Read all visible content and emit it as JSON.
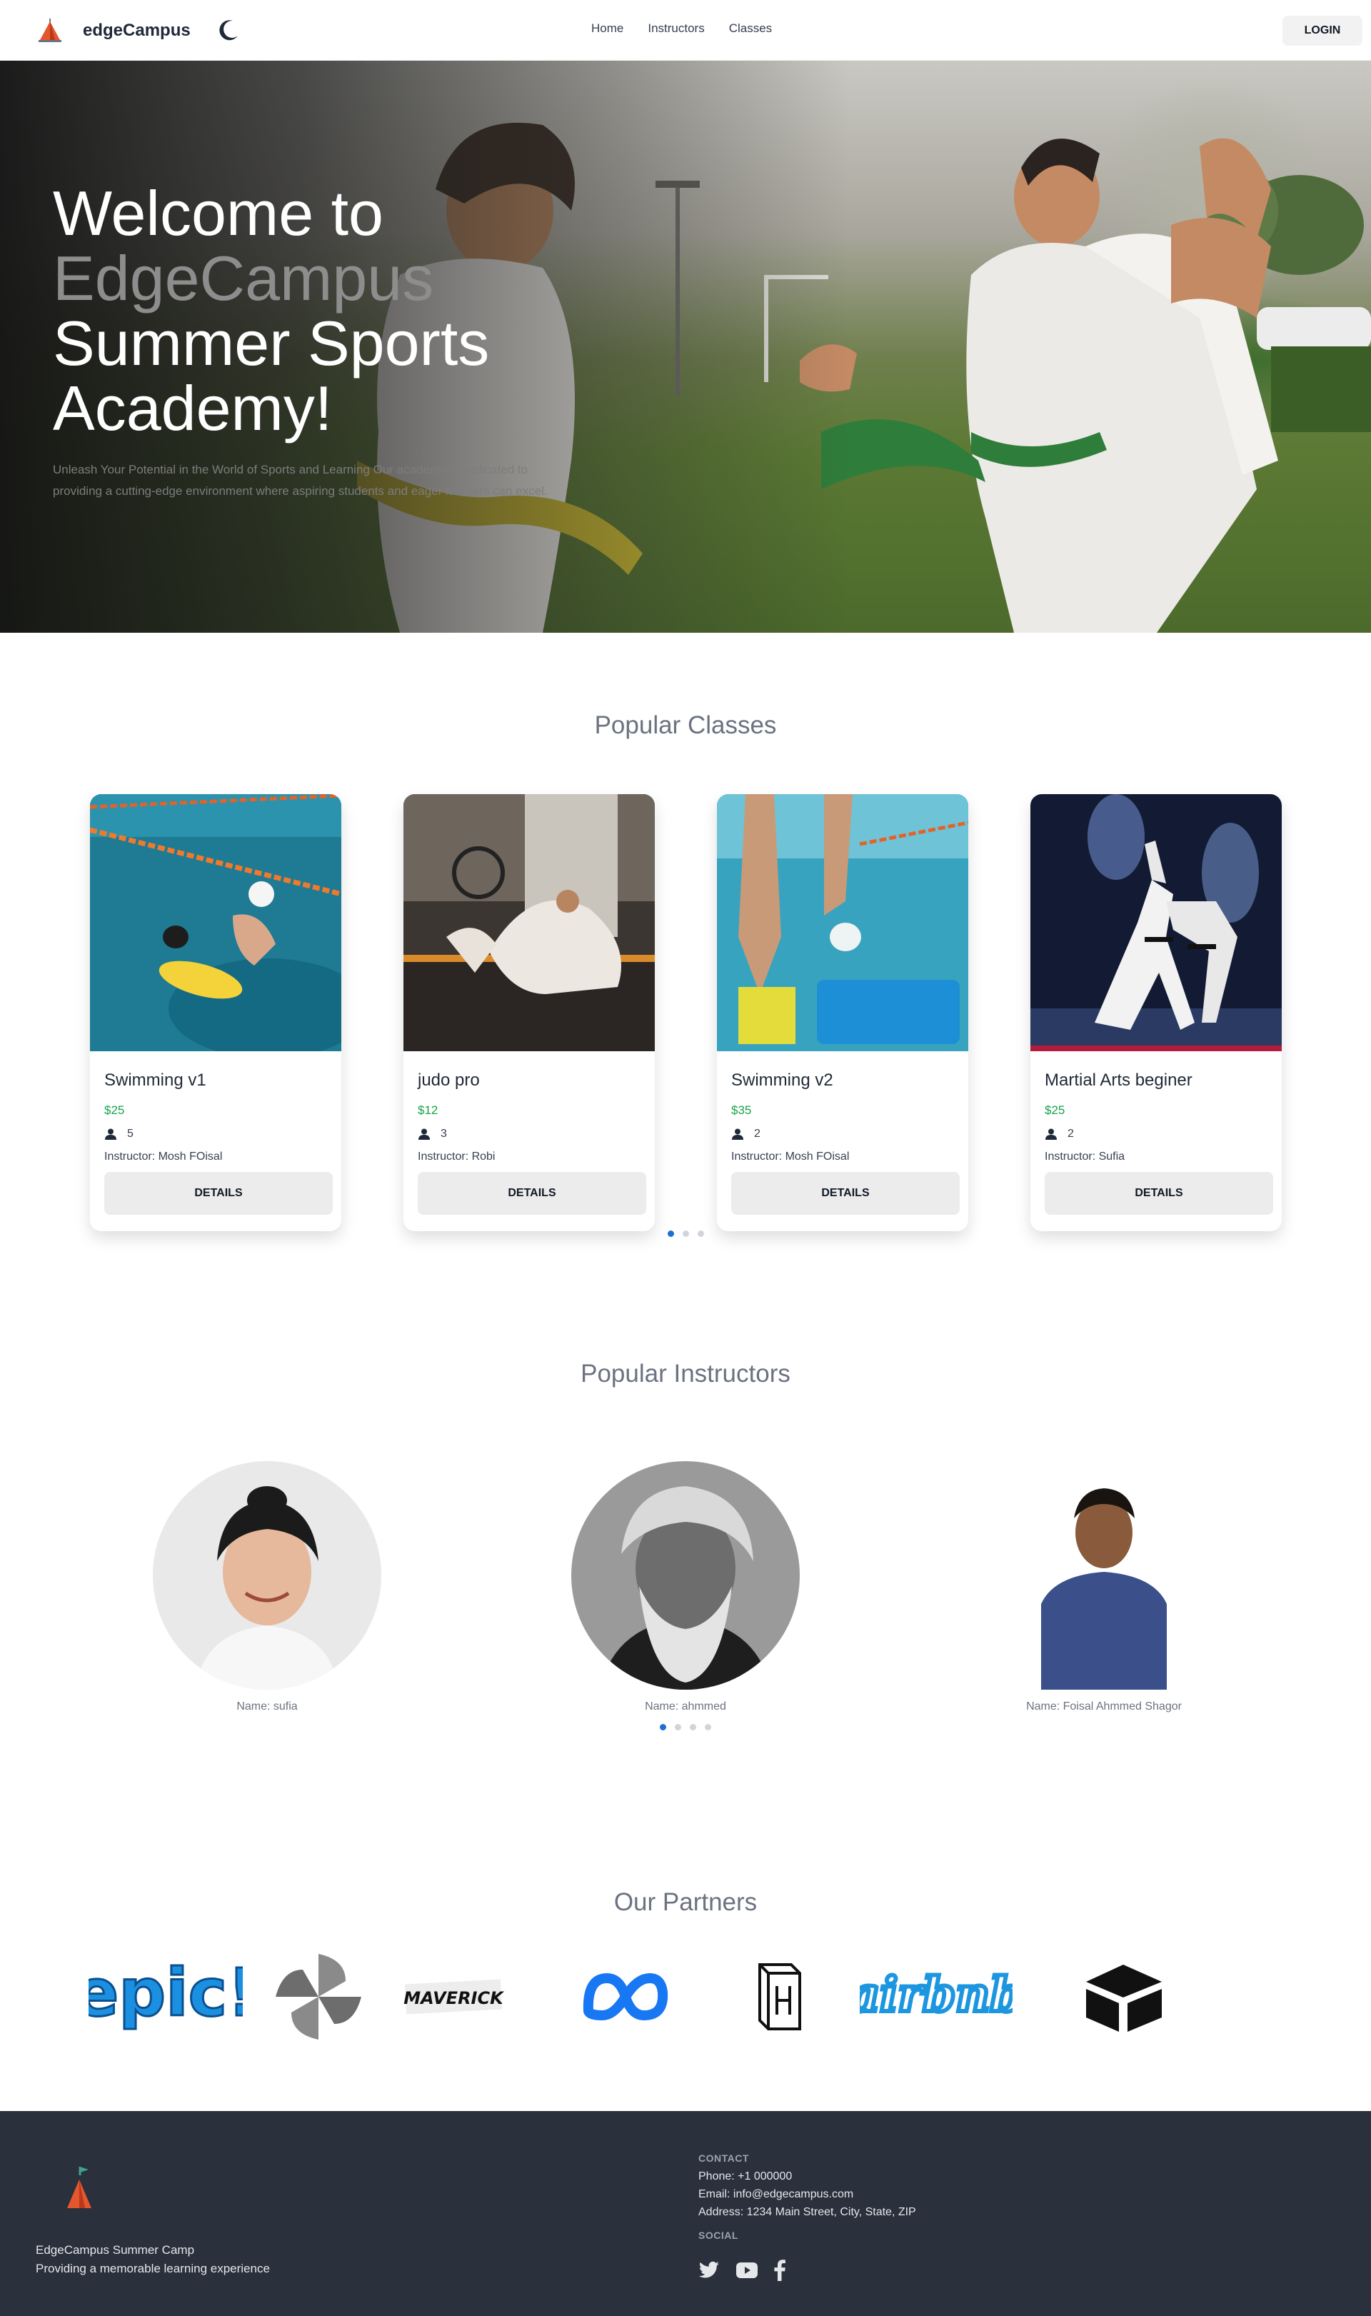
{
  "navbar": {
    "brand": "edgeCampus",
    "links": [
      "Home",
      "Instructors",
      "Classes"
    ],
    "login": "LOGIN",
    "theme_icon": "moon-icon"
  },
  "hero": {
    "title_line1": "Welcome to",
    "title_accent": "EdgeCampus",
    "title_line3": "Summer Sports",
    "title_line4": "Academy!",
    "subtitle": "Unleash Your Potential in the World of Sports and Learning Our academy is dedicated to providing a cutting-edge environment where aspiring students and eager learners can excel."
  },
  "popular_classes": {
    "title": "Popular Classes",
    "details_label": "DETAILS",
    "instructor_prefix": "Instructor: ",
    "cards": [
      {
        "name": "Swimming v1",
        "price": "$25",
        "seats": "5",
        "instructor": "Mosh FOisal"
      },
      {
        "name": "judo pro",
        "price": "$12",
        "seats": "3",
        "instructor": "Robi"
      },
      {
        "name": "Swimming v2",
        "price": "$35",
        "seats": "2",
        "instructor": "Mosh FOisal"
      },
      {
        "name": "Martial Arts beginer",
        "price": "$25",
        "seats": "2",
        "instructor": "Sufia"
      }
    ],
    "pagination": {
      "pages": 3,
      "active": 1
    }
  },
  "popular_instructors": {
    "title": "Popular Instructors",
    "items": [
      {
        "name": "Name: sufia"
      },
      {
        "name": "Name: ahmmed"
      },
      {
        "name": "Name: Foisal Ahmmed Shagor"
      }
    ],
    "pagination": {
      "pages": 4,
      "active": 1
    }
  },
  "partners": {
    "title": "Our Partners",
    "logos": [
      "epic",
      "pinwheel",
      "Maverick",
      "meta",
      "h-box",
      "airbnb",
      "airtable"
    ],
    "epic_text": "epic!",
    "maverick_text": "MAVERICK",
    "airbnb_text": "airbnb"
  },
  "footer": {
    "brand_name": "EdgeCampus Summer Camp",
    "brand_tagline": "Providing a memorable learning experience",
    "contact_title": "CONTACT",
    "phone": "Phone: +1 000000",
    "email": "Email: info@edgecampus.com",
    "address": "Address: 1234 Main Street, City, State, ZIP",
    "social_title": "SOCIAL"
  },
  "colors": {
    "accent_blue": "#1d6fd6",
    "price_green": "#16a34a",
    "footer_bg": "#2a303c"
  }
}
